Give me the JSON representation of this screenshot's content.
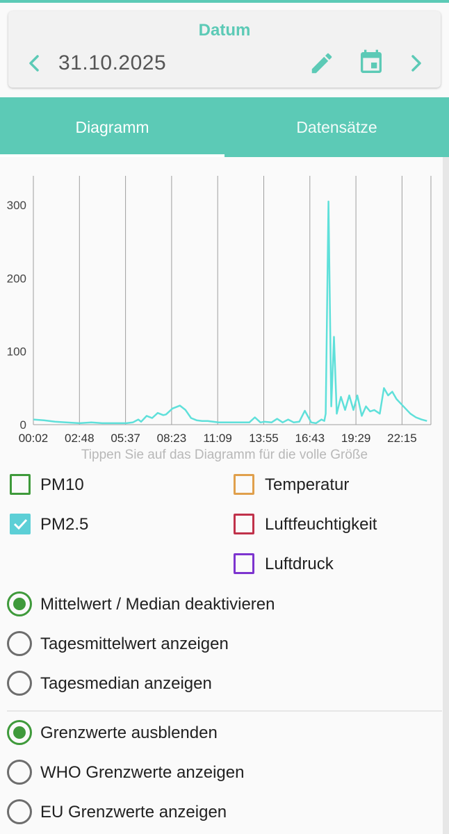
{
  "date_card": {
    "title": "Datum",
    "value": "31.10.2025",
    "icons": [
      "chevron-left-icon",
      "pencil-icon",
      "calendar-icon",
      "chevron-right-icon"
    ]
  },
  "tabs": [
    {
      "label": "Diagramm",
      "active": true
    },
    {
      "label": "Datensätze",
      "active": false
    }
  ],
  "chart_data": {
    "type": "line",
    "title": "",
    "xlabel": "",
    "ylabel": "",
    "x_ticks": [
      "00:02",
      "02:48",
      "05:37",
      "08:23",
      "11:09",
      "13:55",
      "16:43",
      "19:29",
      "22:15"
    ],
    "y_ticks": [
      "0",
      "100",
      "200",
      "300"
    ],
    "ylim": [
      0,
      340
    ],
    "grid": "vertical",
    "series": [
      {
        "color": "#5fe0da",
        "x": [
          "00:02",
          "00:40",
          "01:20",
          "02:00",
          "02:48",
          "03:30",
          "04:10",
          "04:50",
          "05:37",
          "06:00",
          "06:20",
          "06:30",
          "06:50",
          "07:10",
          "07:30",
          "07:50",
          "08:00",
          "08:23",
          "08:50",
          "09:10",
          "09:30",
          "09:50",
          "10:10",
          "10:30",
          "11:09",
          "12:00",
          "13:00",
          "13:20",
          "13:40",
          "13:55",
          "14:20",
          "14:40",
          "15:00",
          "15:20",
          "15:40",
          "16:00",
          "16:20",
          "16:43",
          "17:00",
          "17:20",
          "17:30",
          "17:35",
          "17:45",
          "17:55",
          "18:05",
          "18:15",
          "18:30",
          "18:45",
          "19:00",
          "19:15",
          "19:29",
          "19:45",
          "20:00",
          "20:15",
          "20:30",
          "20:50",
          "21:05",
          "21:20",
          "21:35",
          "21:50",
          "22:15",
          "22:40",
          "23:00",
          "23:20",
          "23:40"
        ],
        "y": [
          7,
          6,
          4,
          3,
          2,
          3,
          2,
          2,
          2,
          3,
          7,
          4,
          12,
          9,
          16,
          13,
          14,
          22,
          26,
          20,
          9,
          6,
          5,
          5,
          3,
          3,
          3,
          10,
          3,
          4,
          3,
          8,
          3,
          7,
          3,
          4,
          19,
          3,
          2,
          7,
          5,
          15,
          305,
          25,
          120,
          15,
          38,
          20,
          40,
          20,
          40,
          12,
          25,
          18,
          20,
          15,
          50,
          40,
          45,
          35,
          25,
          15,
          10,
          7,
          5
        ]
      }
    ]
  },
  "hint": "Tippen Sie auf das Diagramm für die volle Größe",
  "checkboxes": {
    "pm10": {
      "label": "PM10",
      "checked": false,
      "color": "#3f9a3b"
    },
    "pm25": {
      "label": "PM2.5",
      "checked": true,
      "color": "#5ccfd6"
    },
    "temp": {
      "label": "Temperatur",
      "checked": false,
      "color": "#e0a04c"
    },
    "hum": {
      "label": "Luftfeuchtigkeit",
      "checked": false,
      "color": "#c0314a"
    },
    "press": {
      "label": "Luftdruck",
      "checked": false,
      "color": "#7d34cf"
    }
  },
  "stat_options": [
    {
      "label": "Mittelwert / Median deaktivieren",
      "selected": true
    },
    {
      "label": "Tagesmittelwert anzeigen",
      "selected": false
    },
    {
      "label": "Tagesmedian anzeigen",
      "selected": false
    }
  ],
  "limit_options": [
    {
      "label": "Grenzwerte ausblenden",
      "selected": true
    },
    {
      "label": "WHO Grenzwerte anzeigen",
      "selected": false
    },
    {
      "label": "EU Grenzwerte anzeigen",
      "selected": false
    }
  ]
}
